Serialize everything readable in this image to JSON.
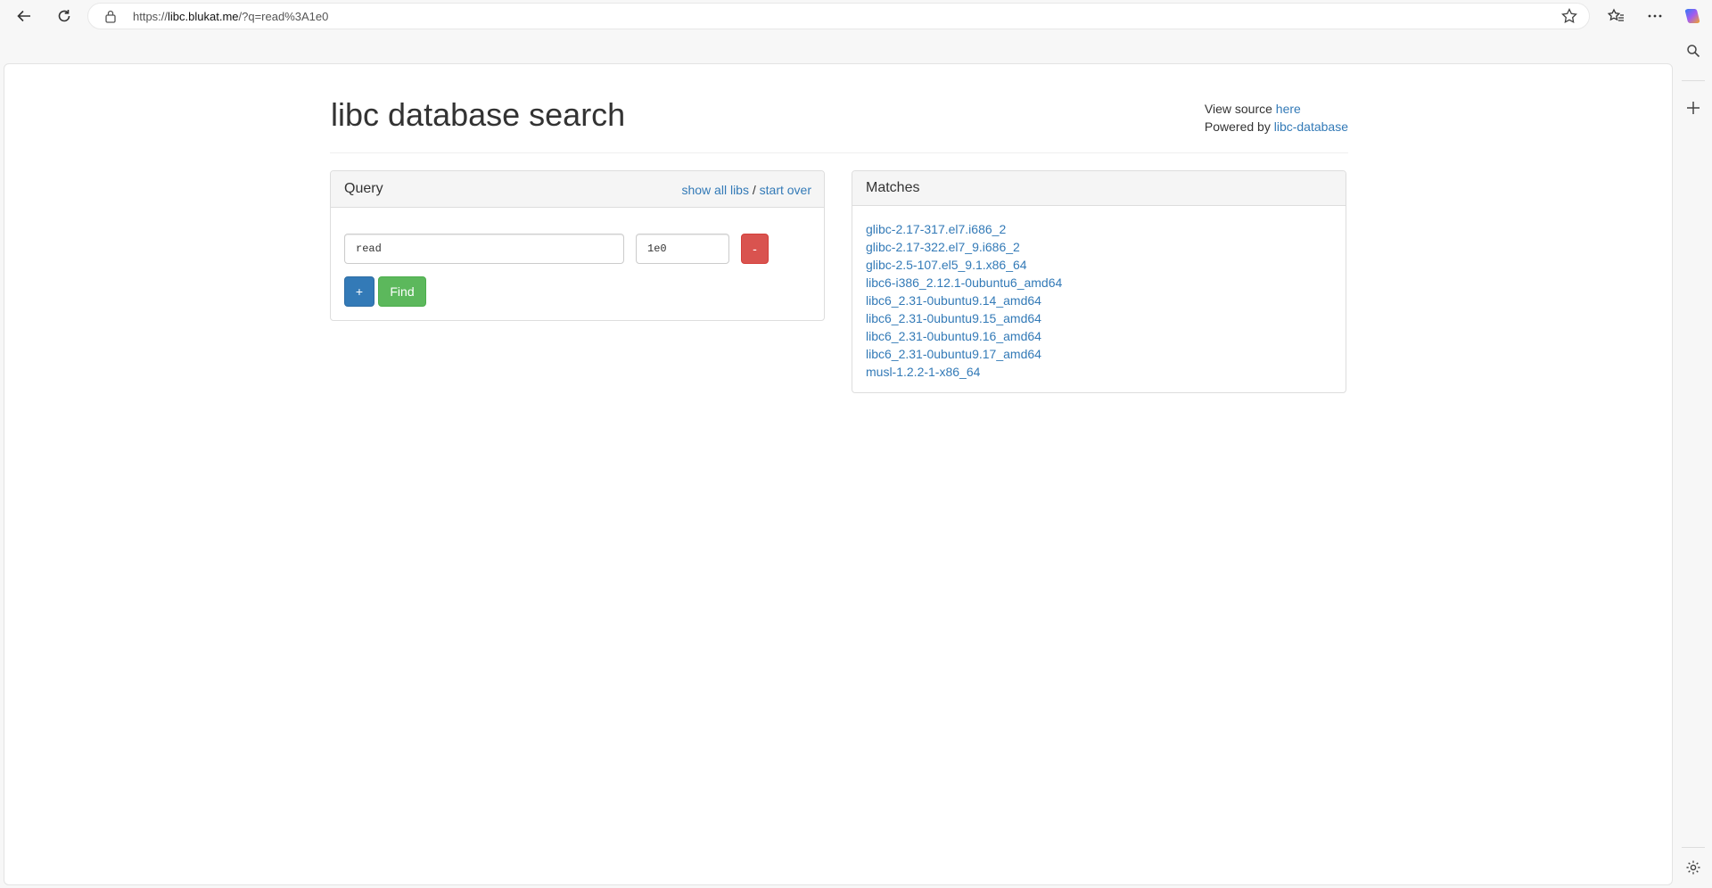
{
  "browser": {
    "url_prefix": "https://",
    "url_host": "libc.blukat.me",
    "url_path": "/?q=read%3A1e0"
  },
  "header": {
    "title": "libc database search",
    "view_source_text": "View source",
    "view_source_link": "here",
    "powered_by_text": "Powered by",
    "powered_by_link": "libc-database"
  },
  "query_panel": {
    "title": "Query",
    "show_all_libs": "show all libs",
    "separator": "/",
    "start_over": "start over",
    "symbol_value": "read",
    "address_value": "1e0",
    "remove_label": "-",
    "add_label": "+",
    "find_label": "Find"
  },
  "matches_panel": {
    "title": "Matches",
    "items": [
      "glibc-2.17-317.el7.i686_2",
      "glibc-2.17-322.el7_9.i686_2",
      "glibc-2.5-107.el5_9.1.x86_64",
      "libc6-i386_2.12.1-0ubuntu6_amd64",
      "libc6_2.31-0ubuntu9.14_amd64",
      "libc6_2.31-0ubuntu9.15_amd64",
      "libc6_2.31-0ubuntu9.16_amd64",
      "libc6_2.31-0ubuntu9.17_amd64",
      "musl-1.2.2-1-x86_64"
    ]
  },
  "colors": {
    "link": "#337ab7",
    "danger": "#d9534f",
    "primary": "#337ab7",
    "success": "#5cb85c"
  }
}
